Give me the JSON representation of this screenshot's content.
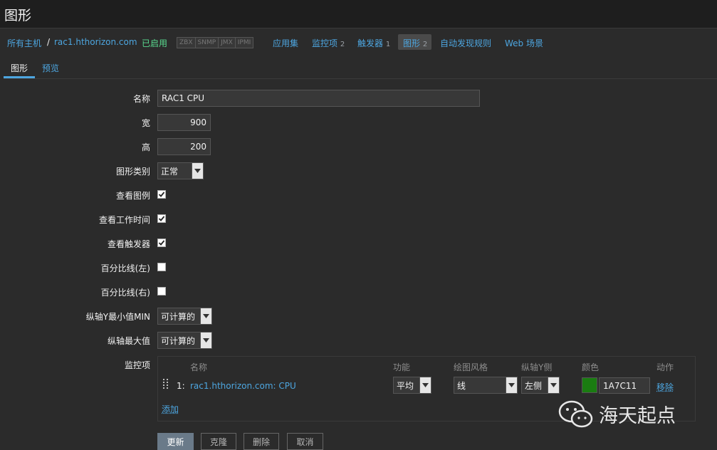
{
  "page": {
    "title": "图形"
  },
  "breadcrumb": {
    "all_hosts": "所有主机",
    "sep": "/",
    "host": "rac1.hthorizon.com",
    "status": "已启用",
    "protocols": [
      "ZBX",
      "SNMP",
      "JMX",
      "IPMI"
    ],
    "apps": "应用集",
    "items_label": "监控项",
    "items_count": "2",
    "triggers_label": "触发器",
    "triggers_count": "1",
    "graphs_label": "图形",
    "graphs_count": "2",
    "discovery": "自动发现规则",
    "web": "Web 场景"
  },
  "tabs": {
    "graph": "图形",
    "preview": "预览"
  },
  "form": {
    "name_label": "名称",
    "name_value": "RAC1 CPU",
    "width_label": "宽",
    "width_value": "900",
    "height_label": "高",
    "height_value": "200",
    "type_label": "图形类别",
    "type_value": "正常",
    "legend_label": "查看图例",
    "legend_checked": true,
    "worktime_label": "查看工作时间",
    "worktime_checked": true,
    "triggers_label": "查看触发器",
    "triggers_checked": true,
    "pleft_label": "百分比线(左)",
    "pleft_checked": false,
    "pright_label": "百分比线(右)",
    "pright_checked": false,
    "ymin_label": "纵轴Y最小值MIN",
    "ymin_value": "可计算的",
    "ymax_label": "纵轴最大值",
    "ymax_value": "可计算的",
    "items_label": "监控项"
  },
  "items_table": {
    "headers": {
      "name": "名称",
      "func": "功能",
      "style": "绘图风格",
      "yaxis": "纵轴Y侧",
      "color": "颜色",
      "action": "动作"
    },
    "rows": [
      {
        "index": "1:",
        "name": "rac1.hthorizon.com: CPU",
        "func": "平均",
        "style": "线",
        "yaxis": "左侧",
        "color_hex": "1A7C11",
        "color": "#1A7C11",
        "remove": "移除"
      }
    ],
    "add": "添加"
  },
  "buttons": {
    "update": "更新",
    "clone": "克隆",
    "delete": "删除",
    "cancel": "取消"
  },
  "watermark": {
    "text": "海天起点"
  },
  "colors": {
    "link": "#4da6e0",
    "enabled": "#59db8f",
    "bg": "#2b2b2b"
  }
}
